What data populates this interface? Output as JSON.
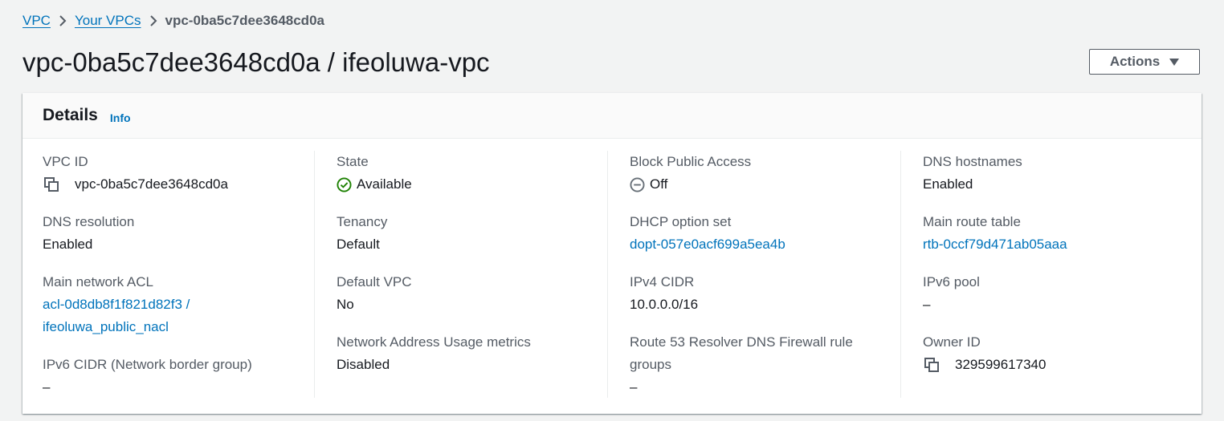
{
  "breadcrumb": {
    "items": [
      "VPC",
      "Your VPCs"
    ],
    "current": "vpc-0ba5c7dee3648cd0a"
  },
  "page": {
    "title": "vpc-0ba5c7dee3648cd0a / ifeoluwa-vpc",
    "actions_label": "Actions"
  },
  "details": {
    "header": "Details",
    "info_link": "Info",
    "vpc_id": {
      "label": "VPC ID",
      "value": "vpc-0ba5c7dee3648cd0a"
    },
    "state": {
      "label": "State",
      "value": "Available"
    },
    "block_public_access": {
      "label": "Block Public Access",
      "value": "Off"
    },
    "dns_hostnames": {
      "label": "DNS hostnames",
      "value": "Enabled"
    },
    "dns_resolution": {
      "label": "DNS resolution",
      "value": "Enabled"
    },
    "tenancy": {
      "label": "Tenancy",
      "value": "Default"
    },
    "dhcp_option_set": {
      "label": "DHCP option set",
      "value": "dopt-057e0acf699a5ea4b"
    },
    "main_route_table": {
      "label": "Main route table",
      "value": "rtb-0ccf79d471ab05aaa"
    },
    "main_network_acl": {
      "label": "Main network ACL",
      "value_line1": "acl-0d8db8f1f821d82f3 /",
      "value_line2": "ifeoluwa_public_nacl"
    },
    "default_vpc": {
      "label": "Default VPC",
      "value": "No"
    },
    "ipv4_cidr": {
      "label": "IPv4 CIDR",
      "value": "10.0.0.0/16"
    },
    "ipv6_pool": {
      "label": "IPv6 pool",
      "value": "–"
    },
    "ipv6_cidr": {
      "label": "IPv6 CIDR (Network border group)",
      "value": "–"
    },
    "nau_metrics": {
      "label": "Network Address Usage metrics",
      "value": "Disabled"
    },
    "route53": {
      "label_line1": "Route 53 Resolver DNS Firewall rule",
      "label_line2": "groups",
      "value": "–"
    },
    "owner_id": {
      "label": "Owner ID",
      "value": "329599617340"
    }
  },
  "colors": {
    "link": "#0073bb",
    "success": "#1d8102",
    "muted": "#687078"
  }
}
